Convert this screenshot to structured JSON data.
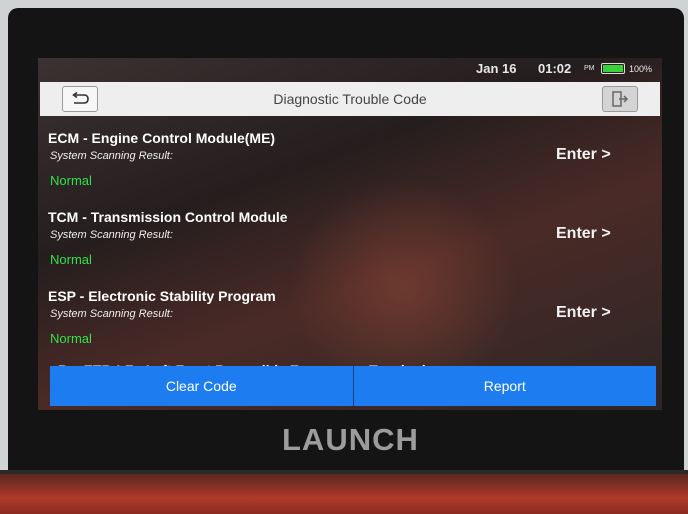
{
  "status": {
    "date": "Jan 16",
    "time": "01:02",
    "ampm": "PM",
    "battery": "100%",
    "battery_level": 1.0
  },
  "header": {
    "title": "Diagnostic Trouble Code"
  },
  "modules": [
    {
      "name": "ECM - Engine Control Module(ME)",
      "subtitle": "System Scanning Result:",
      "status": "Normal",
      "action": "Enter >"
    },
    {
      "name": "TCM - Transmission Control Module",
      "subtitle": "System Scanning Result:",
      "status": "Normal",
      "action": "Enter >"
    },
    {
      "name": "ESP - Electronic Stability Program",
      "subtitle": "System Scanning Result:",
      "status": "Normal",
      "action": "Enter >"
    }
  ],
  "partial_module": "RevETR-LF - Left Front Reversible Emergency Tensioning",
  "footer": {
    "clear_code": "Clear Code",
    "report": "Report"
  },
  "device": {
    "brand": "LAUNCH"
  },
  "colors": {
    "accent": "#1d7df0",
    "status_ok": "#35e04a",
    "titlebar": "#eeeeee"
  }
}
